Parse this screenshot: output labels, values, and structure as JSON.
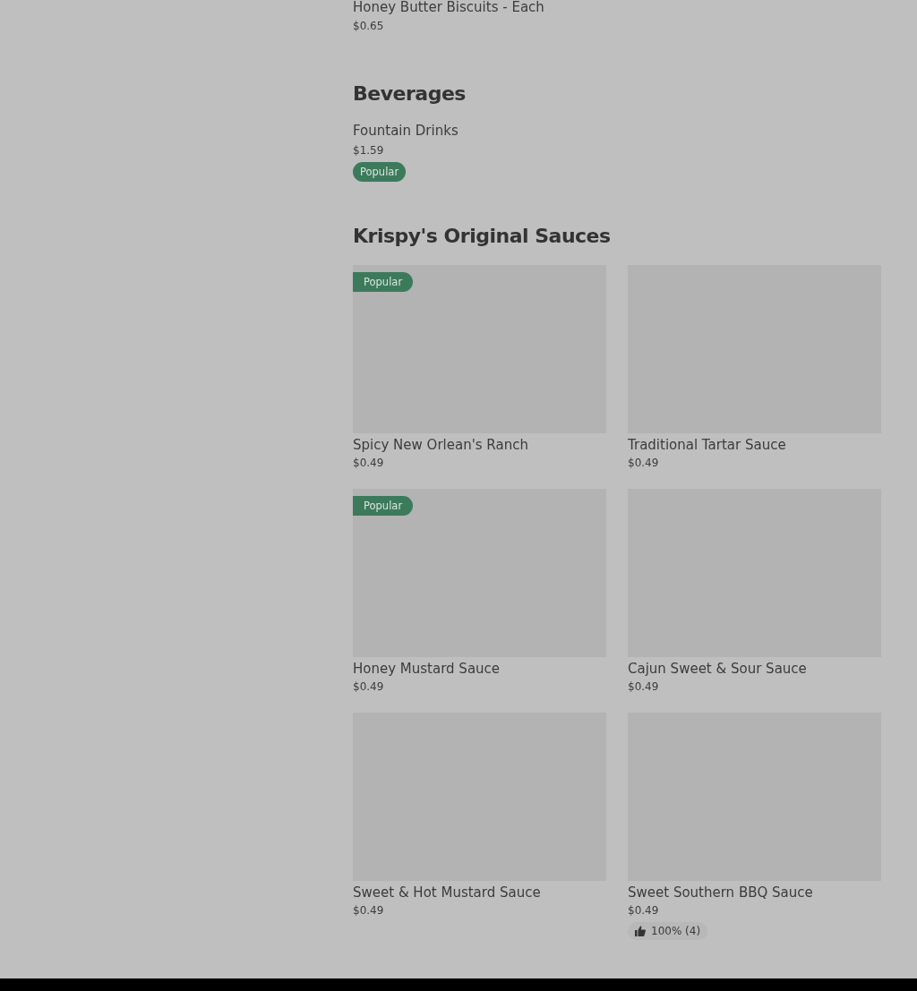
{
  "previous_item": {
    "name": "Honey Butter Biscuits - Each",
    "price": "$0.65"
  },
  "sections": [
    {
      "kind": "list",
      "title": "Beverages",
      "items": [
        {
          "name": "Fountain Drinks",
          "price": "$1.59",
          "badge": "Popular"
        }
      ]
    },
    {
      "kind": "grid",
      "title": "Krispy's Original Sauces",
      "items": [
        {
          "name": "Spicy New Orlean's Ranch",
          "price": "$0.49",
          "badge": "Popular"
        },
        {
          "name": "Traditional Tartar Sauce",
          "price": "$0.49"
        },
        {
          "name": "Honey Mustard Sauce",
          "price": "$0.49",
          "badge": "Popular"
        },
        {
          "name": "Cajun Sweet & Sour Sauce",
          "price": "$0.49"
        },
        {
          "name": "Sweet & Hot Mustard Sauce",
          "price": "$0.49"
        },
        {
          "name": "Sweet Southern BBQ Sauce",
          "price": "$0.49",
          "rating": "100% (4)"
        }
      ]
    }
  ]
}
